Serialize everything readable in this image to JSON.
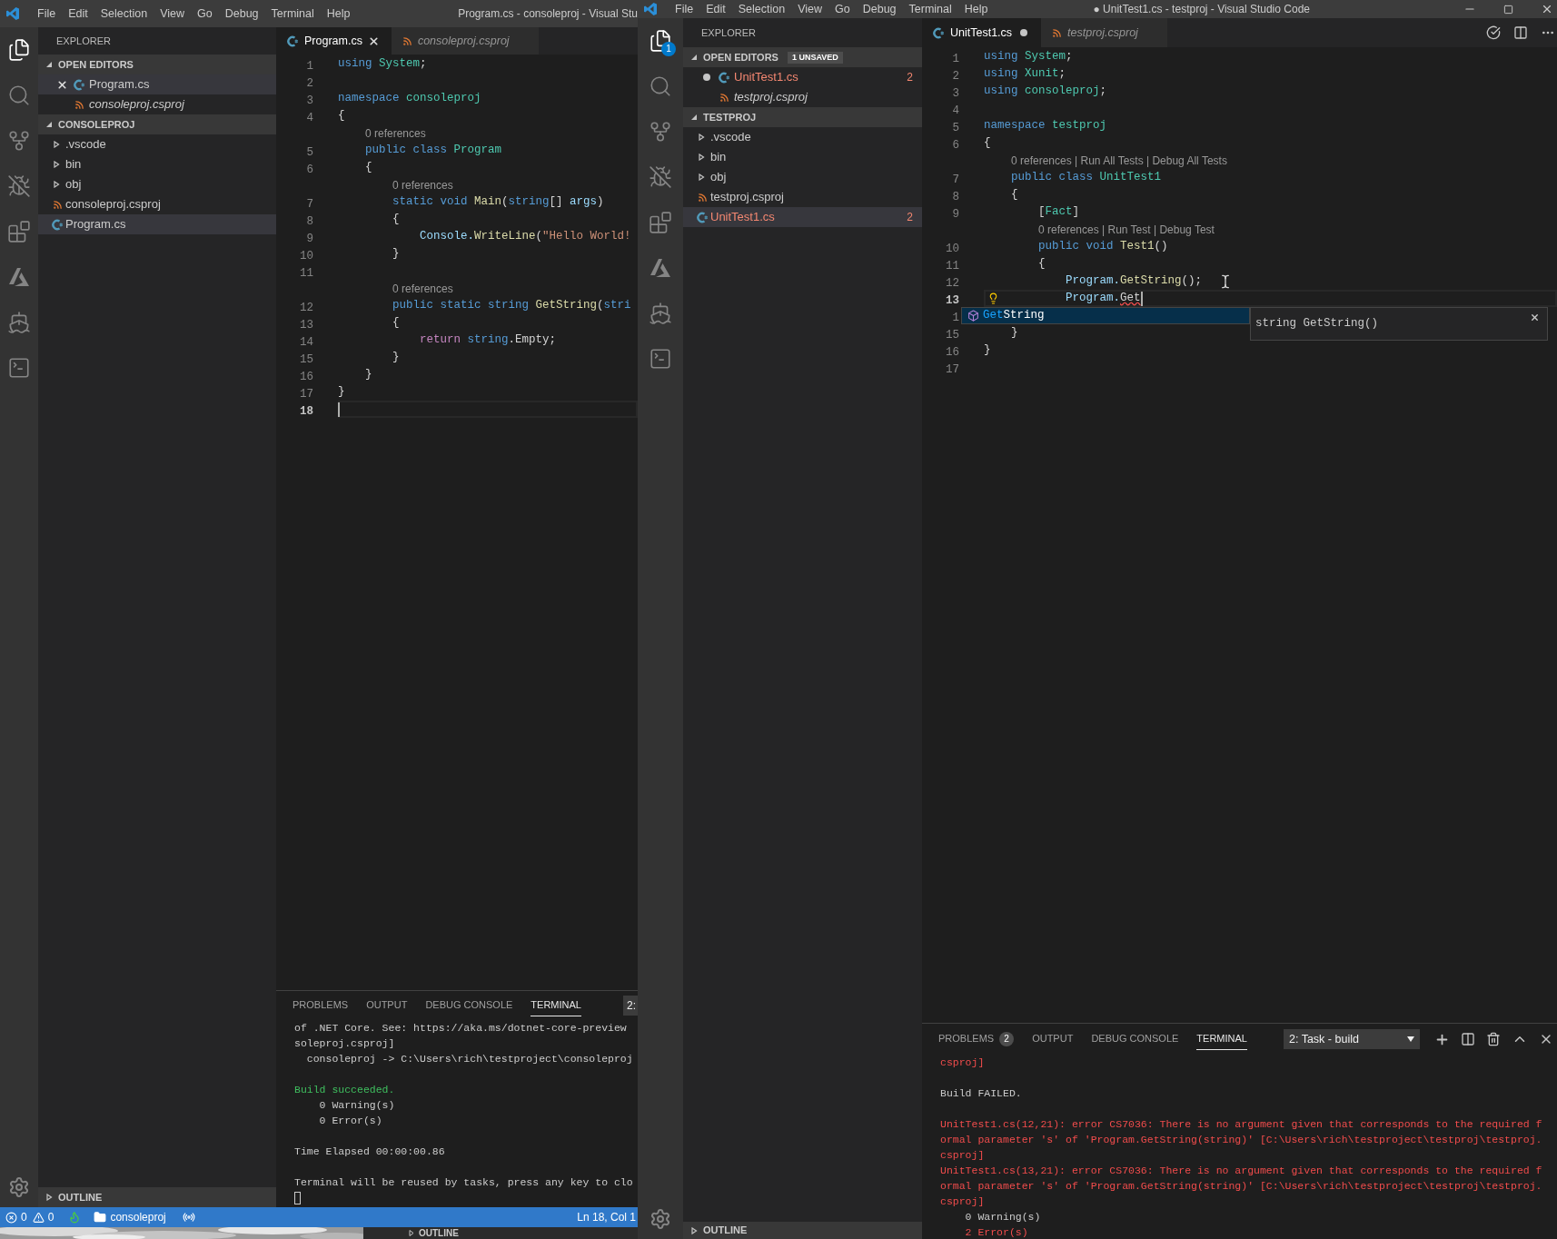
{
  "left_window": {
    "menu": [
      "File",
      "Edit",
      "Selection",
      "View",
      "Go",
      "Debug",
      "Terminal",
      "Help"
    ],
    "title": "Program.cs - consoleproj - Visual Stu",
    "activity_bar": [
      {
        "kind": "files",
        "selected": true
      },
      {
        "kind": "search",
        "selected": false
      },
      {
        "kind": "scm",
        "selected": false
      },
      {
        "kind": "debug",
        "selected": false
      },
      {
        "kind": "extensions",
        "selected": false
      },
      {
        "kind": "azure",
        "selected": false
      },
      {
        "kind": "docker",
        "selected": false
      },
      {
        "kind": "terminal",
        "selected": false
      }
    ],
    "sidebar": {
      "title": "EXPLORER",
      "sections": [
        {
          "label": "OPEN EDITORS",
          "kind": "editors",
          "expanded": true,
          "items": [
            {
              "kind": "csharp",
              "label": "Program.cs",
              "italic": false,
              "selected": true,
              "dirty": false,
              "has_errors": false
            },
            {
              "kind": "msbuild",
              "label": "consoleproj.csproj",
              "italic": true,
              "selected": false,
              "dirty": false,
              "has_errors": false
            }
          ]
        },
        {
          "label": "CONSOLEPROJ",
          "kind": "tree",
          "expanded": true,
          "items": [
            {
              "kind": "folder",
              "label": ".vscode",
              "expanded": false
            },
            {
              "kind": "folder",
              "label": "bin",
              "expanded": false
            },
            {
              "kind": "folder",
              "label": "obj",
              "expanded": false
            },
            {
              "kind": "msbuild",
              "label": "consoleproj.csproj",
              "selected": false,
              "has_errors": false
            },
            {
              "kind": "csharp",
              "label": "Program.cs",
              "selected": true,
              "has_errors": false
            }
          ]
        }
      ],
      "outline": {
        "label": "OUTLINE",
        "expanded": false
      }
    },
    "tabs": [
      {
        "label": "Program.cs",
        "kind": "csharp",
        "selected": true,
        "italic": false,
        "dirty": false
      },
      {
        "label": "consoleproj.csproj",
        "kind": "msbuild",
        "selected": false,
        "italic": true,
        "dirty": false
      }
    ],
    "code": [
      {
        "kind": "code",
        "number": "1",
        "tokens": [
          {
            "text": "using",
            "kind": "keyword"
          },
          {
            "text": " System",
            "kind": "type"
          },
          {
            "text": ";",
            "kind": "plain"
          }
        ]
      },
      {
        "kind": "code",
        "number": "2"
      },
      {
        "kind": "code",
        "number": "3",
        "tokens": [
          {
            "text": "namespace",
            "kind": "keyword"
          },
          {
            "text": " consoleproj",
            "kind": "type"
          }
        ]
      },
      {
        "kind": "code",
        "number": "4",
        "tokens": [
          {
            "text": "{",
            "kind": "plain"
          }
        ]
      },
      {
        "kind": "lens",
        "text": "0 references"
      },
      {
        "kind": "code",
        "number": "5",
        "tokens": [
          {
            "text": "    public class",
            "kind": "keyword"
          },
          {
            "text": " Program",
            "kind": "type"
          }
        ]
      },
      {
        "kind": "code",
        "number": "6",
        "tokens": [
          {
            "text": "    {",
            "kind": "plain"
          }
        ]
      },
      {
        "kind": "lens",
        "text": "0 references"
      },
      {
        "kind": "code",
        "number": "7",
        "tokens": [
          {
            "text": "        static void",
            "kind": "keyword"
          },
          {
            "text": " Main",
            "kind": "func"
          },
          {
            "text": "(",
            "kind": "plain"
          },
          {
            "text": "string",
            "kind": "keyword"
          },
          {
            "text": "[] ",
            "kind": "plain"
          },
          {
            "text": "args",
            "kind": "param"
          },
          {
            "text": ")",
            "kind": "plain"
          }
        ]
      },
      {
        "kind": "code",
        "number": "8",
        "tokens": [
          {
            "text": "        {",
            "kind": "plain"
          }
        ]
      },
      {
        "kind": "code",
        "number": "9",
        "tokens": [
          {
            "text": "            Console.",
            "kind": "param"
          },
          {
            "text": "WriteLine",
            "kind": "func"
          },
          {
            "text": "(",
            "kind": "plain"
          },
          {
            "text": "\"Hello World!",
            "kind": "string"
          }
        ]
      },
      {
        "kind": "code",
        "number": "10",
        "tokens": [
          {
            "text": "        }",
            "kind": "plain"
          }
        ]
      },
      {
        "kind": "code",
        "number": "11"
      },
      {
        "kind": "lens",
        "text": "0 references"
      },
      {
        "kind": "code",
        "number": "12",
        "tokens": [
          {
            "text": "        public static string",
            "kind": "keyword"
          },
          {
            "text": " GetString",
            "kind": "func"
          },
          {
            "text": "(",
            "kind": "plain"
          },
          {
            "text": "stri",
            "kind": "keyword"
          }
        ]
      },
      {
        "kind": "code",
        "number": "13",
        "tokens": [
          {
            "text": "        {",
            "kind": "plain"
          }
        ]
      },
      {
        "kind": "code",
        "number": "14",
        "tokens": [
          {
            "text": "            return",
            "kind": "control"
          },
          {
            "text": " string",
            "kind": "keyword"
          },
          {
            "text": ".Empty;",
            "kind": "plain"
          }
        ]
      },
      {
        "kind": "code",
        "number": "15",
        "tokens": [
          {
            "text": "        }",
            "kind": "plain"
          }
        ]
      },
      {
        "kind": "code",
        "number": "16",
        "tokens": [
          {
            "text": "    }",
            "kind": "plain"
          }
        ]
      },
      {
        "kind": "code",
        "number": "17",
        "tokens": [
          {
            "text": "}",
            "kind": "plain"
          }
        ]
      },
      {
        "kind": "code",
        "number": "18",
        "current": true
      }
    ],
    "panel": {
      "kind": "narrow",
      "tabs": [
        {
          "label": "PROBLEMS",
          "selected": false
        },
        {
          "label": "OUTPUT",
          "selected": false
        },
        {
          "label": "DEBUG CONSOLE",
          "selected": false
        },
        {
          "label": "TERMINAL",
          "selected": true
        }
      ],
      "selector": "2:",
      "lines": [
        {
          "kind": "normal",
          "text": "of .NET Core. See: https://aka.ms/dotnet-core-preview"
        },
        {
          "kind": "normal",
          "text": "soleproj.csproj]"
        },
        {
          "kind": "normal",
          "text": "  consoleproj -> C:\\Users\\rich\\testproject\\consoleproj"
        },
        {
          "kind": "blank"
        },
        {
          "kind": "success",
          "text": "Build succeeded."
        },
        {
          "kind": "normal",
          "text": "    0 Warning(s)"
        },
        {
          "kind": "normal",
          "text": "    0 Error(s)"
        },
        {
          "kind": "blank"
        },
        {
          "kind": "normal",
          "text": "Time Elapsed 00:00:00.86"
        },
        {
          "kind": "blank"
        },
        {
          "kind": "normal",
          "text": "Terminal will be reused by tasks, press any key to clo"
        },
        {
          "kind": "cursor"
        }
      ]
    },
    "status_bar": {
      "errors": "0",
      "warnings": "0",
      "folder": "consoleproj",
      "position": "Ln 18, Col 1"
    }
  },
  "background_window": {
    "outline_label": "OUTLINE"
  },
  "right_window": {
    "menu": [
      "File",
      "Edit",
      "Selection",
      "View",
      "Go",
      "Debug",
      "Terminal",
      "Help"
    ],
    "title": "● UnitTest1.cs - testproj - Visual Studio Code",
    "activity_bar": [
      {
        "kind": "files",
        "selected": true,
        "badge": "1"
      },
      {
        "kind": "search",
        "selected": false
      },
      {
        "kind": "scm",
        "selected": false
      },
      {
        "kind": "debug",
        "selected": false
      },
      {
        "kind": "extensions",
        "selected": false
      },
      {
        "kind": "azure",
        "selected": false
      },
      {
        "kind": "docker",
        "selected": false
      },
      {
        "kind": "terminal",
        "selected": false
      }
    ],
    "sidebar": {
      "title": "EXPLORER",
      "sections": [
        {
          "label": "OPEN EDITORS",
          "kind": "editors",
          "badge": "1 UNSAVED",
          "expanded": true,
          "items": [
            {
              "kind": "csharp",
              "label": "UnitTest1.cs",
              "italic": false,
              "selected": false,
              "dirty": true,
              "has_errors": true,
              "problems": "2"
            },
            {
              "kind": "msbuild",
              "label": "testproj.csproj",
              "italic": true,
              "selected": false,
              "dirty": false,
              "has_errors": false
            }
          ]
        },
        {
          "label": "TESTPROJ",
          "kind": "tree",
          "expanded": true,
          "items": [
            {
              "kind": "folder",
              "label": ".vscode",
              "expanded": false
            },
            {
              "kind": "folder",
              "label": "bin",
              "expanded": false
            },
            {
              "kind": "folder",
              "label": "obj",
              "expanded": false
            },
            {
              "kind": "msbuild",
              "label": "testproj.csproj",
              "selected": false,
              "has_errors": false
            },
            {
              "kind": "csharp",
              "label": "UnitTest1.cs",
              "selected": true,
              "has_errors": true,
              "problems": "2"
            }
          ]
        }
      ],
      "outline": {
        "label": "OUTLINE",
        "expanded": false
      }
    },
    "tabs": [
      {
        "label": "UnitTest1.cs",
        "kind": "csharp",
        "selected": true,
        "italic": false,
        "dirty": true
      },
      {
        "label": "testproj.csproj",
        "kind": "msbuild",
        "selected": false,
        "italic": true,
        "dirty": false
      }
    ],
    "code": [
      {
        "kind": "code",
        "number": "1",
        "tokens": [
          {
            "text": "using",
            "kind": "keyword"
          },
          {
            "text": " System",
            "kind": "type"
          },
          {
            "text": ";",
            "kind": "plain"
          }
        ]
      },
      {
        "kind": "code",
        "number": "2",
        "tokens": [
          {
            "text": "using",
            "kind": "keyword"
          },
          {
            "text": " Xunit",
            "kind": "type"
          },
          {
            "text": ";",
            "kind": "plain"
          }
        ]
      },
      {
        "kind": "code",
        "number": "3",
        "tokens": [
          {
            "text": "using",
            "kind": "keyword"
          },
          {
            "text": " consoleproj",
            "kind": "type"
          },
          {
            "text": ";",
            "kind": "plain"
          }
        ]
      },
      {
        "kind": "code",
        "number": "4"
      },
      {
        "kind": "code",
        "number": "5",
        "tokens": [
          {
            "text": "namespace",
            "kind": "keyword"
          },
          {
            "text": " testproj",
            "kind": "type"
          }
        ]
      },
      {
        "kind": "code",
        "number": "6",
        "tokens": [
          {
            "text": "{",
            "kind": "plain"
          }
        ]
      },
      {
        "kind": "lens",
        "text": "0 references | Run All Tests | Debug All Tests"
      },
      {
        "kind": "code",
        "number": "7",
        "tokens": [
          {
            "text": "    public class",
            "kind": "keyword"
          },
          {
            "text": " UnitTest1",
            "kind": "type"
          }
        ]
      },
      {
        "kind": "code",
        "number": "8",
        "tokens": [
          {
            "text": "    {",
            "kind": "plain"
          }
        ]
      },
      {
        "kind": "code",
        "number": "9",
        "tokens": [
          {
            "text": "        [",
            "kind": "plain"
          },
          {
            "text": "Fact",
            "kind": "type"
          },
          {
            "text": "]",
            "kind": "plain"
          }
        ]
      },
      {
        "kind": "lens",
        "text": "0 references | Run Test | Debug Test"
      },
      {
        "kind": "code",
        "number": "10",
        "tokens": [
          {
            "text": "        public void",
            "kind": "keyword"
          },
          {
            "text": " Test1",
            "kind": "func"
          },
          {
            "text": "()",
            "kind": "plain"
          }
        ]
      },
      {
        "kind": "code",
        "number": "11",
        "tokens": [
          {
            "text": "        {",
            "kind": "plain"
          }
        ]
      },
      {
        "kind": "code",
        "number": "12",
        "tokens": [
          {
            "text": "            Program.",
            "kind": "param"
          },
          {
            "text": "GetString",
            "kind": "func"
          },
          {
            "text": "();",
            "kind": "plain"
          }
        ],
        "pointer": true
      },
      {
        "kind": "code",
        "number": "13",
        "tokens": [
          {
            "text": "            Program.",
            "kind": "param"
          },
          {
            "text": "Get",
            "kind": "error"
          }
        ],
        "current": true,
        "lightbulb": true
      },
      {
        "kind": "code",
        "number": "1"
      },
      {
        "kind": "code",
        "number": "15",
        "tokens": [
          {
            "text": "    }",
            "kind": "plain"
          }
        ]
      },
      {
        "kind": "code",
        "number": "16",
        "tokens": [
          {
            "text": "}",
            "kind": "plain"
          }
        ]
      },
      {
        "kind": "code",
        "number": "17"
      }
    ],
    "suggest": {
      "match": "Get",
      "rest": "String",
      "detail": "string GetString()"
    },
    "panel": {
      "kind": "wide",
      "tabs": [
        {
          "label": "PROBLEMS",
          "selected": false,
          "badge": "2"
        },
        {
          "label": "OUTPUT",
          "selected": false
        },
        {
          "label": "DEBUG CONSOLE",
          "selected": false
        },
        {
          "label": "TERMINAL",
          "selected": true
        }
      ],
      "selector": "2: Task - build",
      "lines": [
        {
          "kind": "error",
          "text": "csproj]"
        },
        {
          "kind": "blank"
        },
        {
          "kind": "normal",
          "text": "Build FAILED."
        },
        {
          "kind": "blank"
        },
        {
          "kind": "error",
          "text": "UnitTest1.cs(12,21): error CS7036: There is no argument given that corresponds to the required f"
        },
        {
          "kind": "error",
          "text": "ormal parameter 's' of 'Program.GetString(string)' [C:\\Users\\rich\\testproject\\testproj\\testproj."
        },
        {
          "kind": "error",
          "text": "csproj]"
        },
        {
          "kind": "error",
          "text": "UnitTest1.cs(13,21): error CS7036: There is no argument given that corresponds to the required f"
        },
        {
          "kind": "error",
          "text": "ormal parameter 's' of 'Program.GetString(string)' [C:\\Users\\rich\\testproject\\testproj\\testproj."
        },
        {
          "kind": "error",
          "text": "csproj]"
        },
        {
          "kind": "normal",
          "text": "    0 Warning(s)"
        },
        {
          "kind": "error",
          "text": "    2 Error(s)"
        }
      ]
    }
  }
}
